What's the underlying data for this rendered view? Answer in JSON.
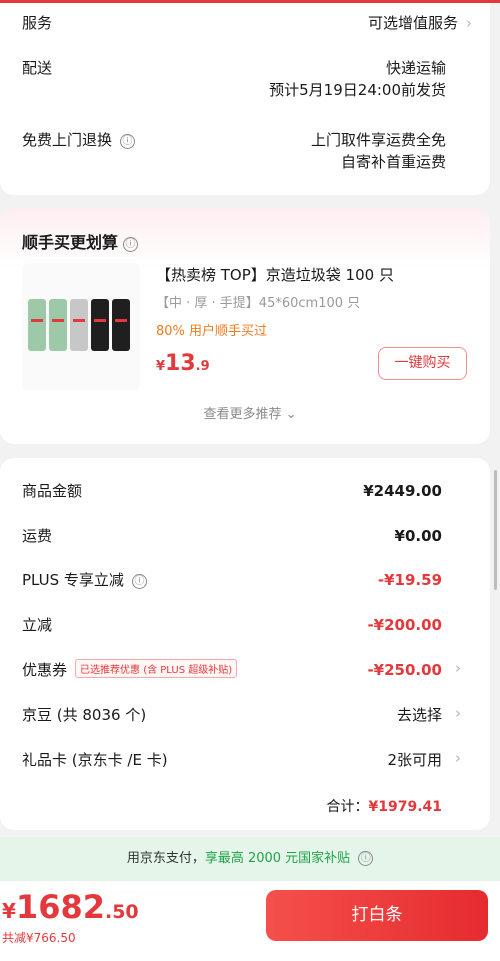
{
  "service": {
    "label": "服务",
    "value": "可选增值服务",
    "chevron": "›"
  },
  "delivery": {
    "label": "配送",
    "method": "快递运输",
    "eta": "预计5月19日24:00前发货"
  },
  "returns": {
    "label": "免费上门退换",
    "info_icon": "ⓘ",
    "line1": "上门取件享运费全免",
    "line2": "自寄补首重运费"
  },
  "recommend": {
    "title": "顺手买更划算",
    "product": {
      "name": "【热卖榜 TOP】京造垃圾袋 100 只",
      "spec": "【中 · 厚 · 手提】45*60cm100 只",
      "note": "80% 用户顺手买过",
      "price_currency": "¥",
      "price_int": "13",
      "price_dec": ".9",
      "buy_label": "一键购买"
    },
    "more_label": "查看更多推荐",
    "more_icon": "⌄",
    "roll_colors": [
      "#9dc9a9",
      "#9dc9a9",
      "#c7c7c7",
      "#1f1f1f",
      "#1f1f1f"
    ]
  },
  "price_breakdown": {
    "goods": {
      "label": "商品金额",
      "value": "¥2449.00"
    },
    "shipping": {
      "label": "运费",
      "value": "¥0.00"
    },
    "plus": {
      "label": "PLUS 专享立减",
      "value": "-¥19.59"
    },
    "instant": {
      "label": "立减",
      "value": "-¥200.00"
    },
    "coupon": {
      "label": "优惠券",
      "tag": "已选推荐优惠 (含 PLUS 超级补贴)",
      "value": "-¥250.00"
    },
    "beans": {
      "label": "京豆 (共 8036 个)",
      "value": "去选择"
    },
    "giftcard": {
      "label": "礼品卡 (京东卡 /E 卡)",
      "value": "2张可用"
    },
    "total_label": "合计：",
    "total_value": "¥1979.41"
  },
  "banner": {
    "prefix": "用京东支付，",
    "highlight": "享最高 2000 元国家补贴"
  },
  "checkout": {
    "currency": "¥",
    "amount_int": "1682",
    "amount_dec": ".50",
    "saved": "共减¥766.50",
    "button_label": "打白条"
  },
  "colors": {
    "accent": "#e4393c",
    "orange": "#f07b1e",
    "green": "#1fa34a"
  }
}
